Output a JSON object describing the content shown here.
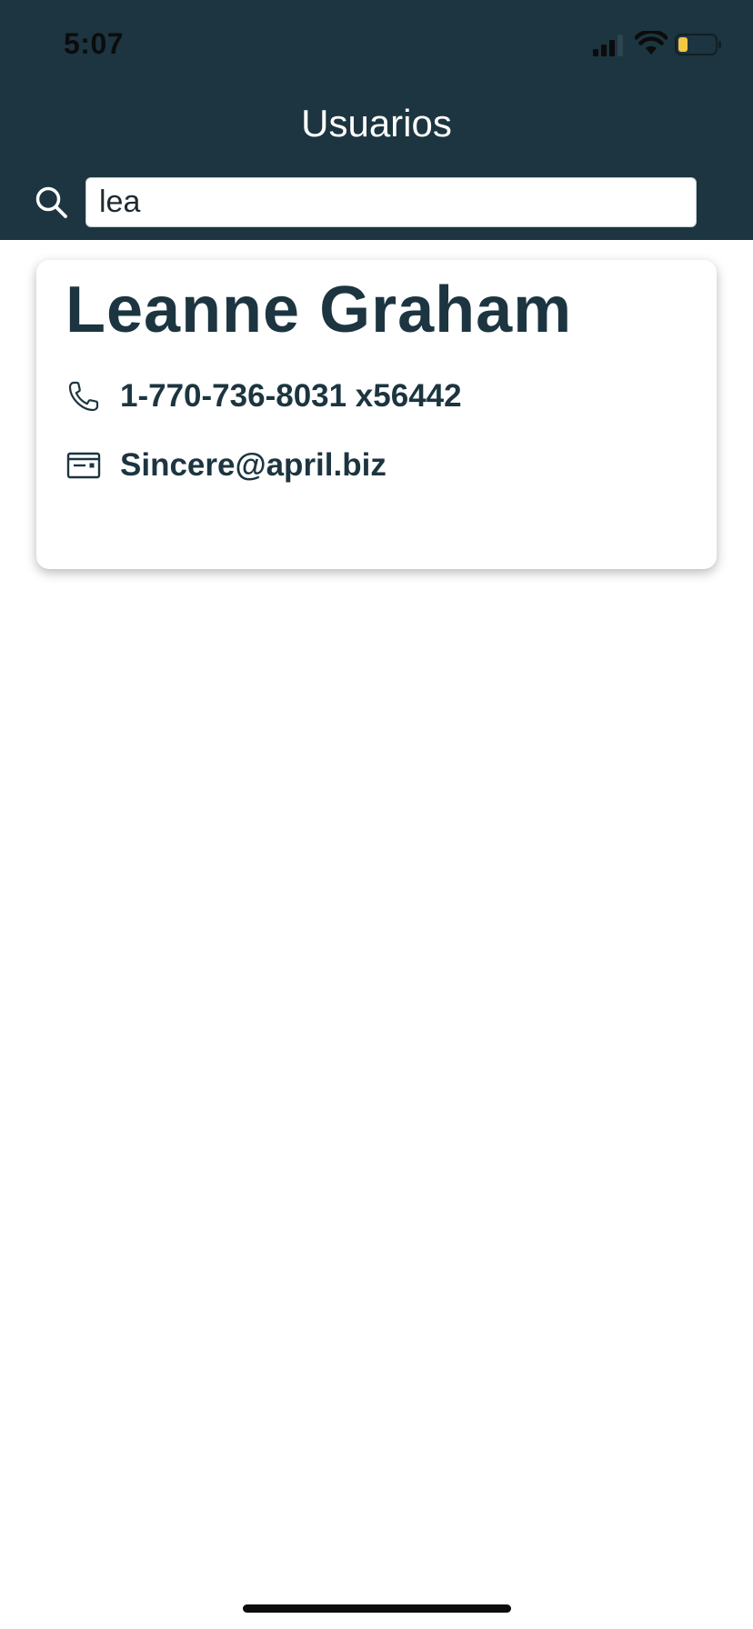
{
  "status_bar": {
    "time": "5:07",
    "signal_icon": "cellular-signal-icon",
    "wifi_icon": "wifi-icon",
    "battery_icon": "battery-low-icon",
    "battery_level": 0.25,
    "battery_color": "#f3c645"
  },
  "header": {
    "title": "Usuarios",
    "background_color": "#1c3540",
    "search": {
      "icon": "search-icon",
      "value": "lea",
      "placeholder": ""
    }
  },
  "results": [
    {
      "name": "Leanne Graham",
      "phone": "1-770-736-8031 x56442",
      "phone_icon": "phone-icon",
      "email": "Sincere@april.biz",
      "email_icon": "id-card-icon"
    }
  ],
  "colors": {
    "primary": "#1c3540",
    "text_on_primary": "#ffffff"
  }
}
